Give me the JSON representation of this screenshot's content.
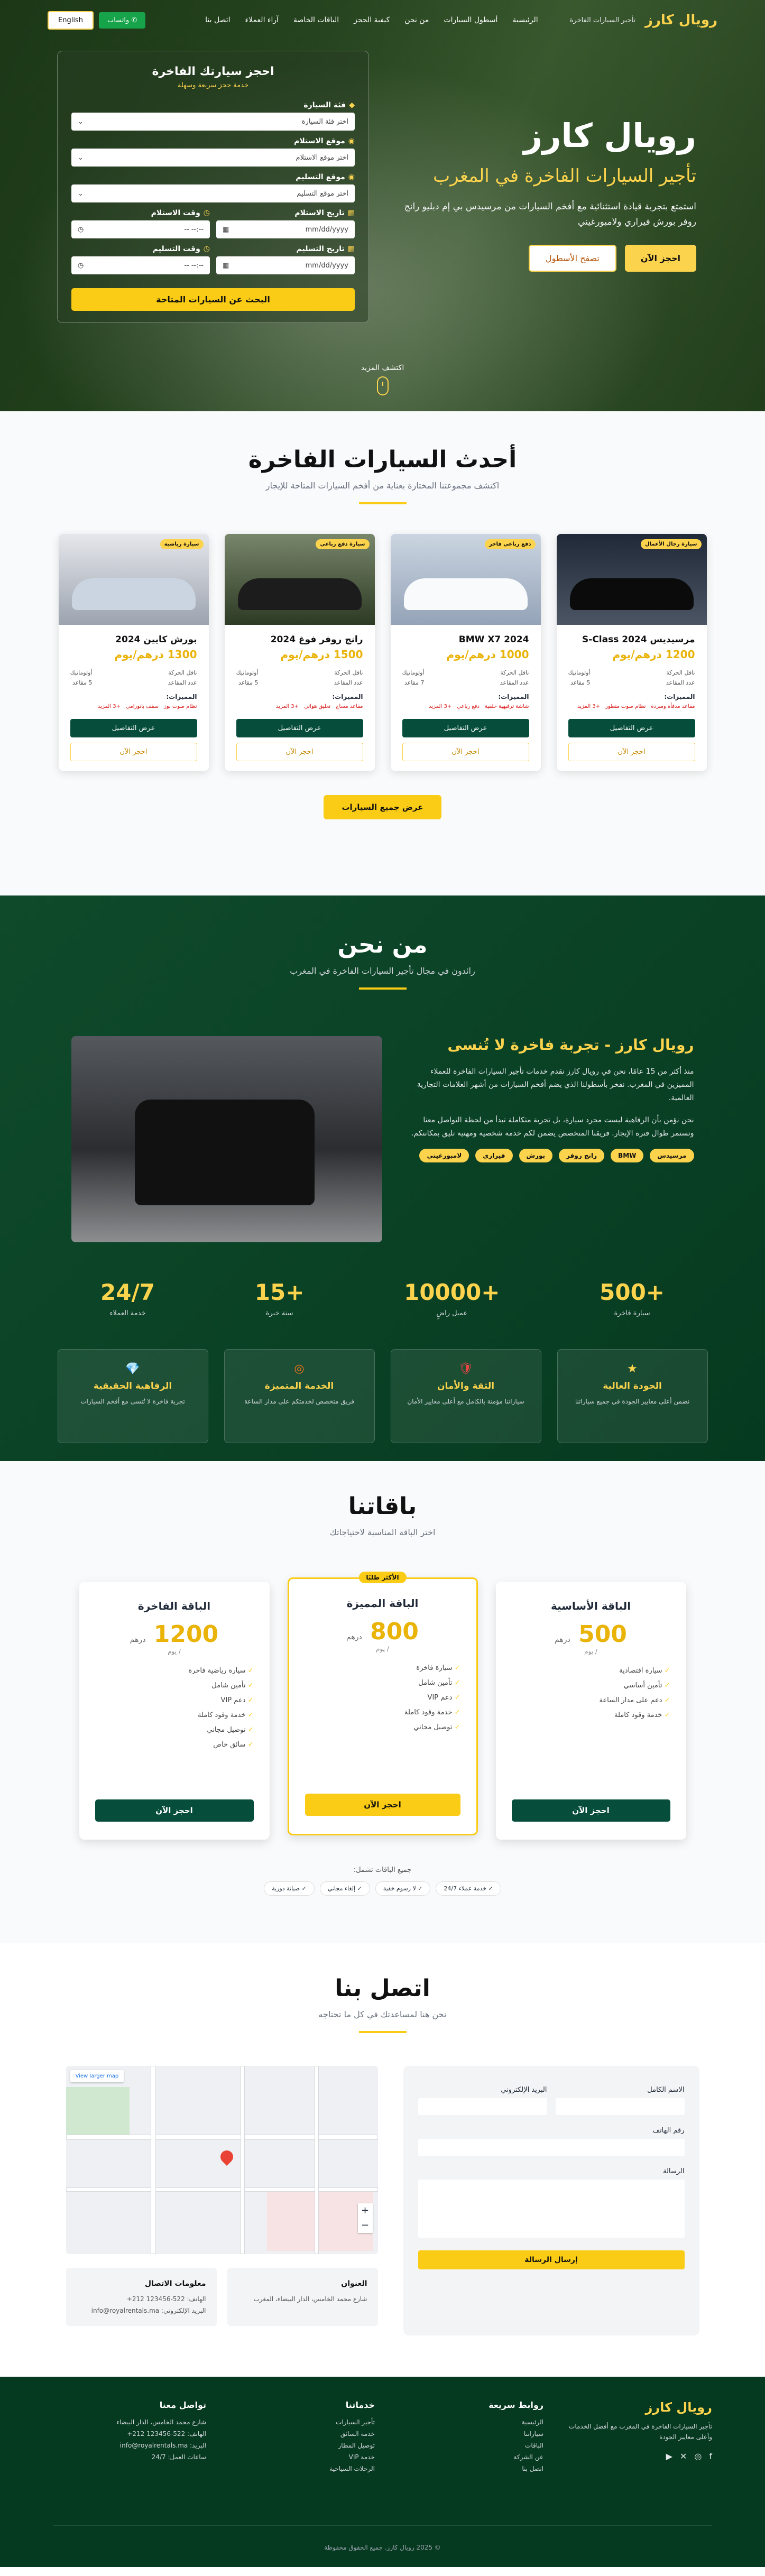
{
  "nav": {
    "logo": "رويال كارز",
    "tagline": "تأجير السيارات الفاخرة",
    "links": [
      "الرئيسية",
      "أسطول السيارات",
      "من نحن",
      "كيفية الحجز",
      "الباقات الخاصة",
      "آراء العملاء",
      "اتصل بنا"
    ],
    "whatsapp": "واتساب",
    "lang": "English"
  },
  "hero": {
    "title": "رويال كارز",
    "subtitle": "تأجير السيارات الفاخرة في المغرب",
    "desc": "استمتع بتجربة قيادة استثنائية مع أفخم السيارات من مرسيدس بي إم دبليو رانج روفر بورش فيراري ولامبورغيني",
    "btn_book": "احجز الآن",
    "btn_fleet": "تصفح الأسطول",
    "more": "اكتشف المزيد"
  },
  "booking": {
    "title": "احجز سيارتك الفاخرة",
    "subtitle": "خدمة حجز سريعة وسهلة",
    "car_class_label": "فئة السيارة",
    "car_class_value": "اختر فئة السيارة",
    "pickup_loc_label": "موقع الاستلام",
    "pickup_loc_value": "اختر موقع الاستلام",
    "return_loc_label": "موقع التسليم",
    "return_loc_value": "اختر موقع التسليم",
    "pickup_date_label": "تاريخ الاستلام",
    "pickup_time_label": "وقت الاستلام",
    "return_date_label": "تاريخ التسليم",
    "return_time_label": "وقت التسليم",
    "date_ph": "mm/dd/yyyy",
    "time_ph": "--:-- --",
    "search": "البحث عن السيارات المتاحة"
  },
  "cars": {
    "title": "أحدث السيارات الفاخرة",
    "subtitle": "اكتشف مجموعتنا المختارة بعناية من أفخم السيارات المتاحة للإيجار",
    "specs_label": "المميزات:",
    "details_btn": "عرض التفاصيل",
    "book_btn": "احجز الآن",
    "all_btn": "عرض جميع السيارات",
    "items": [
      {
        "badge": "سيارة رجال الأعمال",
        "name": "مرسيديس S-Class 2024",
        "price": "1200 درهم/يوم",
        "s1": "ناقل الحركة",
        "s1v": "أوتوماتيك",
        "s2": "عدد المقاعد",
        "s2v": "5 مقاعد",
        "f": [
          "مقاعد مدفأة ومبردة",
          "نظام صوت متطور",
          "+3 المزيد"
        ]
      },
      {
        "badge": "دفع رباعي فاخر",
        "name": "BMW X7 2024",
        "price": "1000 درهم/يوم",
        "s1": "ناقل الحركة",
        "s1v": "أوتوماتيك",
        "s2": "عدد المقاعد",
        "s2v": "7 مقاعد",
        "f": [
          "شاشة ترفيهية خلفية",
          "دفع رباعي",
          "+3 المزيد"
        ]
      },
      {
        "badge": "سيارة دفع رباعي",
        "name": "رانج روفر فوغ 2024",
        "price": "1500 درهم/يوم",
        "s1": "ناقل الحركة",
        "s1v": "أوتوماتيك",
        "s2": "عدد المقاعد",
        "s2v": "5 مقاعد",
        "f": [
          "مقاعد مساج",
          "تعليق هوائي",
          "+3 المزيد"
        ]
      },
      {
        "badge": "سيارة رياضية",
        "name": "بورش كايين 2024",
        "price": "1300 درهم/يوم",
        "s1": "ناقل الحركة",
        "s1v": "أوتوماتيك",
        "s2": "عدد المقاعد",
        "s2v": "5 مقاعد",
        "f": [
          "نظام صوت بوز",
          "سقف بانورامي",
          "+3 المزيد"
        ]
      }
    ]
  },
  "about": {
    "title": "من نحن",
    "subtitle": "رائدون في مجال تأجير السيارات الفاخرة في المغرب",
    "heading": "رويال كارز - تجربة فاخرة لا تُنسى",
    "p1": "منذ أكثر من 15 عامًا، نحن في رويال كارز نقدم خدمات تأجير السيارات الفاخرة للعملاء المميزين في المغرب. نفخر بأسطولنا الذي يضم أفخم السيارات من أشهر العلامات التجارية العالمية.",
    "p2": "نحن نؤمن بأن الرفاهية ليست مجرد سيارة، بل تجربة متكاملة تبدأ من لحظة التواصل معنا وتستمر طوال فترة الإيجار. فريقنا المتخصص يضمن لكم خدمة شخصية ومهنية تليق بمكانتكم.",
    "brands": [
      "مرسيدس",
      "BMW",
      "رانج روفر",
      "بورش",
      "فيراري",
      "لامبورغيني"
    ],
    "stats": [
      {
        "num": "+500",
        "lbl": "سيارة فاخرة"
      },
      {
        "num": "+10000",
        "lbl": "عميل راضٍ"
      },
      {
        "num": "+15",
        "lbl": "سنة خبرة"
      },
      {
        "num": "24/7",
        "lbl": "خدمة العملاء"
      }
    ],
    "values": [
      {
        "icon": "★",
        "t": "الجودة العالية",
        "d": "نضمن أعلى معايير الجودة في جميع سياراتنا"
      },
      {
        "icon": "🛡",
        "t": "الثقة والأمان",
        "d": "سياراتنا مؤمنة بالكامل مع أعلى معايير الأمان"
      },
      {
        "icon": "◎",
        "t": "الخدمة المتميزة",
        "d": "فريق متخصص لخدمتكم على مدار الساعة"
      },
      {
        "icon": "💎",
        "t": "الرفاهية الحقيقية",
        "d": "تجربة فاخرة لا تُنسى مع أفخم السيارات"
      }
    ]
  },
  "packages": {
    "title": "باقاتنا",
    "subtitle": "اختر الباقة المناسبة لاحتياجاتك",
    "popular": "الأكثر طلبًا",
    "per": "/ يوم",
    "currency": "درهم",
    "btn": "احجز الآن",
    "items": [
      {
        "name": "الباقة الأساسية",
        "price": "500",
        "feats": [
          "سيارة اقتصادية",
          "تأمين أساسي",
          "دعم على مدار الساعة",
          "خدمة وقود كاملة"
        ]
      },
      {
        "name": "الباقة المميزة",
        "price": "800",
        "feats": [
          "سيارة فاخرة",
          "تأمين شامل",
          "دعم VIP",
          "خدمة وقود كاملة",
          "توصيل مجاني"
        ]
      },
      {
        "name": "الباقة الفاخرة",
        "price": "1200",
        "feats": [
          "سيارة رياضية فاخرة",
          "تأمين شامل",
          "دعم VIP",
          "خدمة وقود كاملة",
          "توصيل مجاني",
          "سائق خاص"
        ]
      }
    ],
    "included_title": "جميع الباقات تشمل:",
    "included": [
      "✓ خدمة عملاء 24/7",
      "✓ لا رسوم خفية",
      "✓ إلغاء مجاني",
      "✓ صيانة دورية"
    ]
  },
  "contact": {
    "title": "اتصل بنا",
    "subtitle": "نحن هنا لمساعدتك في كل ما تحتاجه",
    "name": "الاسم الكامل",
    "email": "البريد الإلكتروني",
    "phone": "رقم الهاتف",
    "message": "الرسالة",
    "send": "إرسال الرسالة",
    "view_larger": "View larger map",
    "address_t": "العنوان",
    "address": "شارع محمد الخامس، الدار البيضاء، المغرب",
    "info_t": "معلومات الاتصال",
    "phone_v": "الهاتف: 522-123456 212+",
    "email_v": "البريد الإلكتروني: info@royalrentals.ma"
  },
  "footer": {
    "logo": "رويال كارز",
    "about": "تأجير السيارات الفاخرة في المغرب مع أفضل الخدمات وأعلى معايير الجودة",
    "links_t": "روابط سريعة",
    "links": [
      "الرئيسية",
      "سياراتنا",
      "الباقات",
      "عن الشركة",
      "اتصل بنا"
    ],
    "services_t": "خدماتنا",
    "services": [
      "تأجير السيارات",
      "خدمة السائق",
      "توصيل المطار",
      "خدمة VIP",
      "الرحلات السياحية"
    ],
    "contact_t": "تواصل معنا",
    "contact": [
      "شارع محمد الخامس، الدار البيضاء",
      "الهاتف: 522-123456 212+",
      "البريد: info@royalrentals.ma",
      "ساعات العمل: 24/7"
    ],
    "copy": "© 2025 رويال كارز. جميع الحقوق محفوظة"
  }
}
